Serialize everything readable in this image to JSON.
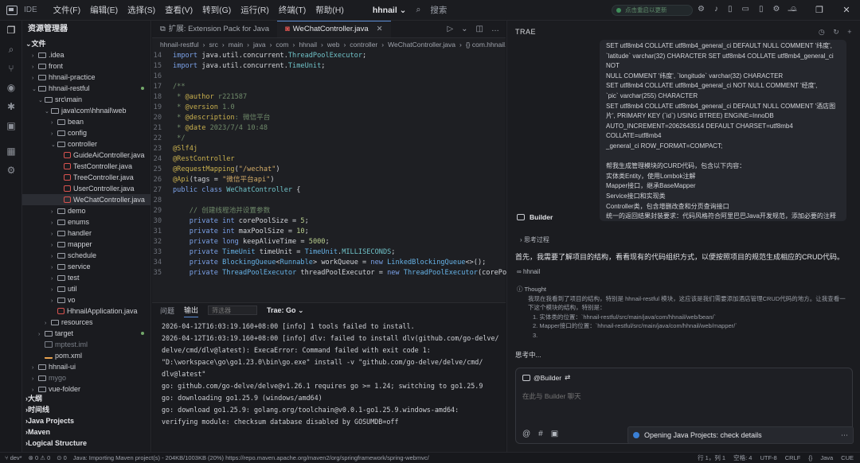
{
  "titlebar": {
    "app": "IDE",
    "menu": [
      "文件(F)",
      "编辑(E)",
      "选择(S)",
      "查看(V)",
      "转到(G)",
      "运行(R)",
      "终端(T)",
      "帮助(H)"
    ],
    "project": "hhnail",
    "search_label": "搜索",
    "update_text": "点击重启以更新"
  },
  "sidebar": {
    "title": "资源管理器",
    "section_files": "文件",
    "items": [
      {
        "label": ".idea",
        "depth": 1,
        "kind": "folder",
        "collapsed": true
      },
      {
        "label": "front",
        "depth": 1,
        "kind": "folder",
        "collapsed": true
      },
      {
        "label": "hhnail-practice",
        "depth": 1,
        "kind": "folder",
        "collapsed": true
      },
      {
        "label": "hhnail-restful",
        "depth": 1,
        "kind": "folder",
        "collapsed": false,
        "dot": true
      },
      {
        "label": "src\\main",
        "depth": 2,
        "kind": "folder",
        "collapsed": false
      },
      {
        "label": "java\\com\\hhnail\\web",
        "depth": 3,
        "kind": "folder",
        "collapsed": false
      },
      {
        "label": "bean",
        "depth": 4,
        "kind": "folder",
        "collapsed": true
      },
      {
        "label": "config",
        "depth": 4,
        "kind": "folder",
        "collapsed": true
      },
      {
        "label": "controller",
        "depth": 4,
        "kind": "folder",
        "collapsed": false
      },
      {
        "label": "GuideAiController.java",
        "depth": 5,
        "kind": "java"
      },
      {
        "label": "TestController.java",
        "depth": 5,
        "kind": "java"
      },
      {
        "label": "TreeController.java",
        "depth": 5,
        "kind": "java"
      },
      {
        "label": "UserController.java",
        "depth": 5,
        "kind": "java"
      },
      {
        "label": "WeChatController.java",
        "depth": 5,
        "kind": "java",
        "selected": true
      },
      {
        "label": "demo",
        "depth": 4,
        "kind": "folder",
        "collapsed": true
      },
      {
        "label": "enums",
        "depth": 4,
        "kind": "folder",
        "collapsed": true
      },
      {
        "label": "handler",
        "depth": 4,
        "kind": "folder",
        "collapsed": true
      },
      {
        "label": "mapper",
        "depth": 4,
        "kind": "folder",
        "collapsed": true
      },
      {
        "label": "schedule",
        "depth": 4,
        "kind": "folder",
        "collapsed": true
      },
      {
        "label": "service",
        "depth": 4,
        "kind": "folder",
        "collapsed": true
      },
      {
        "label": "test",
        "depth": 4,
        "kind": "folder",
        "collapsed": true
      },
      {
        "label": "util",
        "depth": 4,
        "kind": "folder",
        "collapsed": true
      },
      {
        "label": "vo",
        "depth": 4,
        "kind": "folder",
        "collapsed": true
      },
      {
        "label": "HhnailApplication.java",
        "depth": 4,
        "kind": "java"
      },
      {
        "label": "resources",
        "depth": 3,
        "kind": "folder",
        "collapsed": true
      },
      {
        "label": "target",
        "depth": 2,
        "kind": "folder",
        "collapsed": true,
        "dot": true
      },
      {
        "label": "mptest.iml",
        "depth": 2,
        "kind": "file",
        "dim": true
      },
      {
        "label": "pom.xml",
        "depth": 2,
        "kind": "xml"
      },
      {
        "label": "hhnail-ui",
        "depth": 1,
        "kind": "folder",
        "collapsed": true
      },
      {
        "label": "mygo",
        "depth": 1,
        "kind": "folder",
        "collapsed": true,
        "dim": true
      },
      {
        "label": "vue-folder",
        "depth": 1,
        "kind": "folder",
        "collapsed": true
      }
    ],
    "sections": [
      "大纲",
      "时间线",
      "Java Projects",
      "Maven",
      "Logical Structure"
    ]
  },
  "editor": {
    "tabs": [
      {
        "label": "扩展: Extension Pack for Java",
        "active": false
      },
      {
        "label": "WeChatController.java",
        "active": true
      }
    ],
    "breadcrumb": [
      "hhnail-restful",
      "src",
      "main",
      "java",
      "com",
      "hhnail",
      "web",
      "controller",
      "WeChatController.java",
      "{} com.hhnail.w"
    ]
  },
  "panel": {
    "tabs": [
      "问题",
      "输出"
    ],
    "active_tab": "输出",
    "filter_placeholder": "筛选器",
    "channel": "Trae: Go",
    "lines": [
      "2026-04-12T16:03:19.160+08:00 [info] 1 tools failed to install.",
      "",
      "2026-04-12T16:03:19.160+08:00 [info] dlv: failed to install dlv(github.com/go-delve/",
      "delve/cmd/dlv@latest): ExecaError: Command failed with exit code 1:",
      "\"D:\\workspace\\go\\go1.23.0\\bin\\go.exe\" install -v \"github.com/go-delve/delve/cmd/",
      "dlv@latest\"",
      "",
      "go: github.com/go-delve/delve@v1.26.1 requires go >= 1.24; switching to go1.25.9",
      "go: downloading go1.25.9 (windows/amd64)",
      "go: download go1.25.9: golang.org/toolchain@v0.0.1-go1.25.9.windows-amd64:",
      "verifying module: checksum database disabled by GOSUMDB=off"
    ]
  },
  "chat": {
    "title": "TRAE",
    "user_message": [
      "SET utf8mb4 COLLATE utf8mb4_general_ci DEFAULT NULL COMMENT '纬度',",
      "`latitude` varchar(32) CHARACTER SET utf8mb4 COLLATE utf8mb4_general_ci NOT",
      "NULL COMMENT '纬度', `longitude` varchar(32) CHARACTER",
      "SET utf8mb4 COLLATE utf8mb4_general_ci NOT NULL COMMENT '经度',",
      "`pic` varchar(255) CHARACTER",
      "SET utf8mb4 COLLATE utf8mb4_general_ci DEFAULT NULL COMMENT '酒店图",
      "片', PRIMARY KEY (`id`) USING BTREE) ENGINE=InnoDB",
      "AUTO_INCREMENT=2062643514 DEFAULT CHARSET=utf8mb4 COLLATE=utf8mb4",
      "_general_ci ROW_FORMAT=COMPACT;",
      "",
      "帮我生成管理模块的CURD代码，包含以下内容：",
      "实体类Entity，使用Lombok注解",
      "Mapper接口，继承BaseMapper",
      "Service接口和实现类",
      "Controller类，包含增删改查和分页查询接口",
      "统一的返回结果封装要求：代码风格符合阿里巴巴Java开发规范，添加必要的注释"
    ],
    "agent_name": "Builder",
    "thinking_label": "思考过程",
    "reply": "首先，我需要了解项目的结构，看看现有的代码组织方式，以便按照项目的规范生成相应的CRUD代码。",
    "workspace": "hhnail",
    "thought_title": "Thought",
    "thought_body": "我现在我看到了项目的结构，特别是 hhnail-restful 模块，这应该是我们需要添加酒店管理CRUD代码的地方。让我查看一下这个模块的结构，特别是：",
    "thought_items": [
      "1. 实体类的位置：`hhnail-restful/src/main/java/com/hhnail/web/bean/`",
      "2. Mapper接口的位置：`hhnail-restful/src/main/java/com/hhnail/web/mapper/`",
      "3."
    ],
    "status": "思考中...",
    "mention": "@Builder",
    "input_placeholder": "在此与 Builder 聊天"
  },
  "notification": {
    "text": "Opening Java Projects: check details"
  },
  "statusbar": {
    "branch": "dev*",
    "errors": "0",
    "warnings": "0",
    "ports": "0",
    "progress_text": "Java: Importing Maven project(s) - 204KB/1003KB (20%) https://repo.maven.apache.org/maven2/org/springframework/spring-webmvc/",
    "cursor": "行 1，列 1",
    "spaces": "空格: 4",
    "encoding": "UTF-8",
    "eol": "CRLF",
    "language": "Java",
    "lang_cue": "CUE"
  },
  "colors": {
    "accent": "#5b8dd6",
    "java_icon": "#d9534f",
    "notify_dot": "#3a7fd5"
  }
}
